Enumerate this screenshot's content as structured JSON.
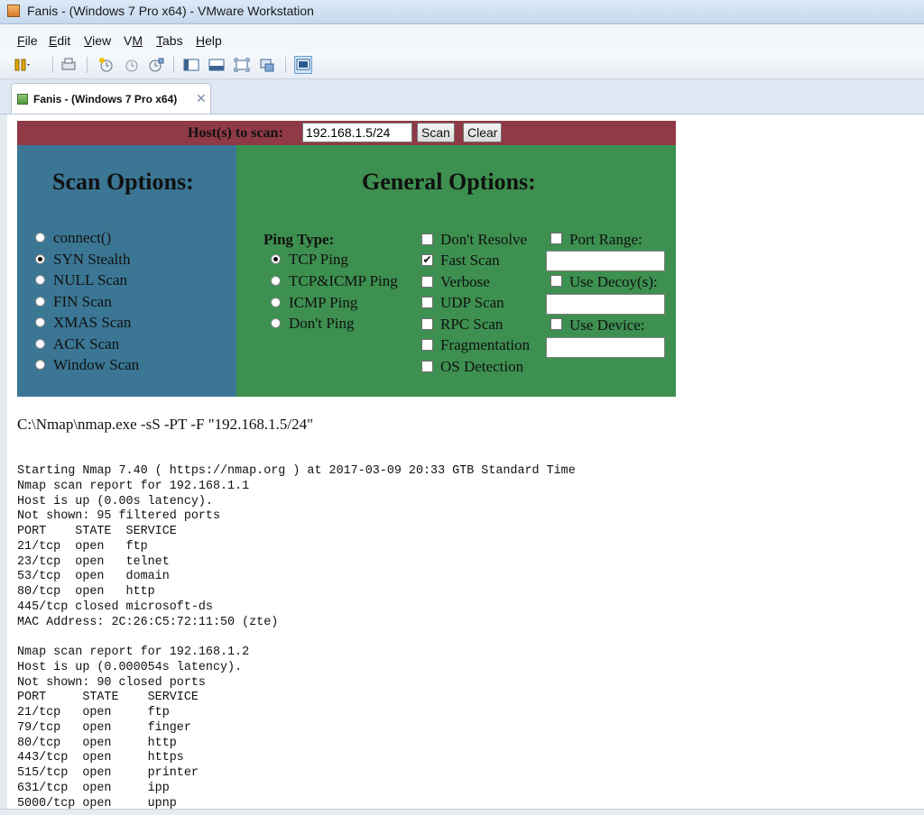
{
  "window": {
    "title": "Fanis - (Windows 7 Pro x64) - VMware Workstation"
  },
  "menu": [
    {
      "label": "File",
      "key": "F",
      "rest": "ile"
    },
    {
      "label": "Edit",
      "key": "E",
      "rest": "dit"
    },
    {
      "label": "View",
      "key": "V",
      "rest": "iew"
    },
    {
      "label": "VM",
      "key": "M",
      "pre": "V"
    },
    {
      "label": "Tabs",
      "key": "T",
      "rest": "abs"
    },
    {
      "label": "Help",
      "key": "H",
      "rest": "elp"
    }
  ],
  "tab": {
    "label": "Fanis - (Windows 7 Pro x64)",
    "close": "✕"
  },
  "nmap": {
    "host_label": "Host(s) to scan:",
    "host_value": "192.168.1.5/24",
    "scan_button": "Scan",
    "clear_button": "Clear",
    "scan_options_title": "Scan Options:",
    "scan_options": [
      {
        "label": "connect()",
        "selected": false
      },
      {
        "label": "SYN Stealth",
        "selected": true
      },
      {
        "label": "NULL Scan",
        "selected": false
      },
      {
        "label": "FIN Scan",
        "selected": false
      },
      {
        "label": "XMAS Scan",
        "selected": false
      },
      {
        "label": "ACK Scan",
        "selected": false
      },
      {
        "label": "Window Scan",
        "selected": false
      }
    ],
    "general_options_title": "General Options:",
    "ping_type_label": "Ping Type:",
    "ping_types": [
      {
        "label": "TCP Ping",
        "selected": true
      },
      {
        "label": "TCP&ICMP Ping",
        "selected": false
      },
      {
        "label": "ICMP Ping",
        "selected": false
      },
      {
        "label": "Don't Ping",
        "selected": false
      }
    ],
    "general_checks": [
      {
        "label": "Don't Resolve",
        "checked": false
      },
      {
        "label": "Fast Scan",
        "checked": true
      },
      {
        "label": "Verbose",
        "checked": false
      },
      {
        "label": "UDP Scan",
        "checked": false
      },
      {
        "label": "RPC Scan",
        "checked": false
      },
      {
        "label": "Fragmentation",
        "checked": false
      },
      {
        "label": "OS Detection",
        "checked": false
      }
    ],
    "port_range_label": "Port Range:",
    "port_range_value": "",
    "decoy_label": "Use Decoy(s):",
    "decoy_value": "",
    "device_label": "Use Device:",
    "device_value": "",
    "command": "C:\\Nmap\\nmap.exe -sS -PT -F \"192.168.1.5/24\"",
    "output": "Starting Nmap 7.40 ( https://nmap.org ) at 2017-03-09 20:33 GTB Standard Time\nNmap scan report for 192.168.1.1\nHost is up (0.00s latency).\nNot shown: 95 filtered ports\nPORT    STATE  SERVICE\n21/tcp  open   ftp\n23/tcp  open   telnet\n53/tcp  open   domain\n80/tcp  open   http\n445/tcp closed microsoft-ds\nMAC Address: 2C:26:C5:72:11:50 (zte)\n\nNmap scan report for 192.168.1.2\nHost is up (0.000054s latency).\nNot shown: 90 closed ports\nPORT     STATE    SERVICE\n21/tcp   open     ftp\n79/tcp   open     finger\n80/tcp   open     http\n443/tcp  open     https\n515/tcp  open     printer\n631/tcp  open     ipp\n5000/tcp open     upnp"
  }
}
